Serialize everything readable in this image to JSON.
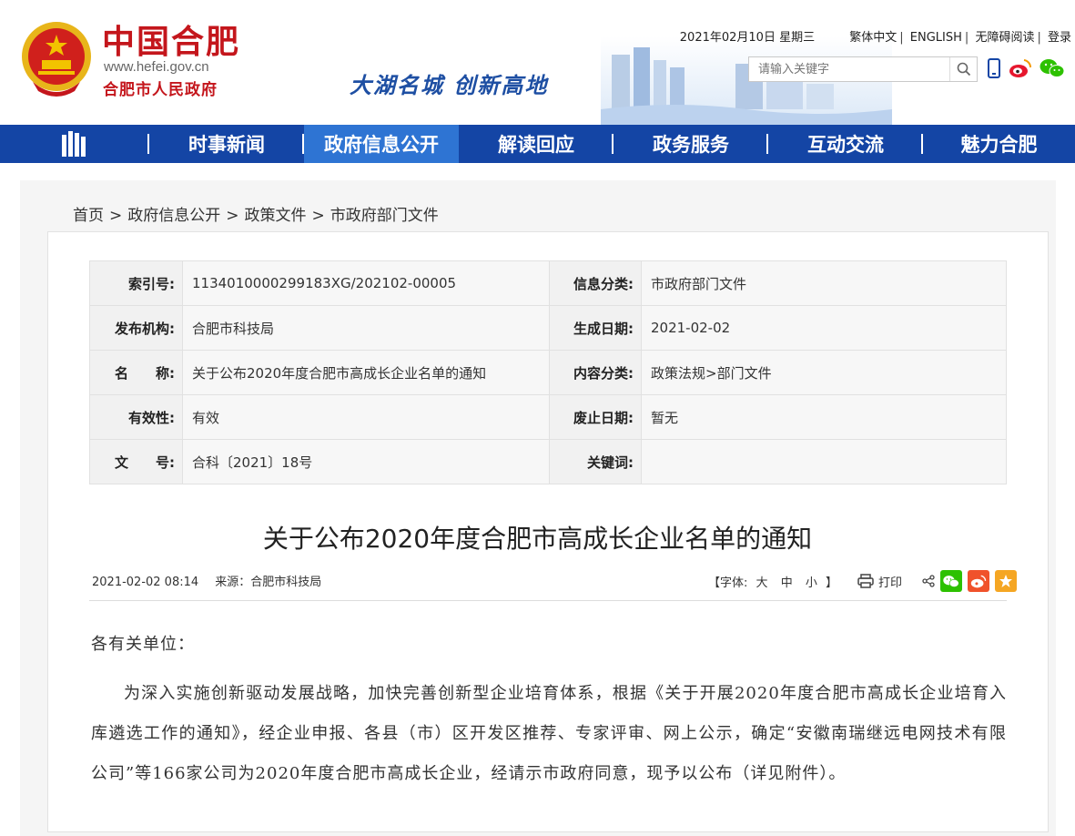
{
  "header": {
    "site_name": "中国合肥",
    "site_url": "www.hefei.gov.cn",
    "site_sub": "合肥市人民政府",
    "slogan": "大湖名城   创新高地",
    "date": "2021年02月10日 星期三",
    "links": [
      "繁体中文",
      "ENGLISH",
      "无障碍阅读",
      "登录"
    ],
    "search_placeholder": "请输入关键字",
    "icons": [
      "mobile-icon",
      "weibo-icon",
      "wechat-icon"
    ]
  },
  "nav": {
    "items": [
      "时事新闻",
      "政府信息公开",
      "解读回应",
      "政务服务",
      "互动交流",
      "魅力合肥"
    ],
    "active": "政府信息公开"
  },
  "breadcrumb": [
    "首页",
    "政府信息公开",
    "政策文件",
    "市政府部门文件"
  ],
  "meta": {
    "rows": [
      {
        "k1": "索引号:",
        "v1": "1134010000299183XG/202102-00005",
        "k2": "信息分类:",
        "v2": "市政府部门文件"
      },
      {
        "k1": "发布机构:",
        "v1": "合肥市科技局",
        "k2": "生成日期:",
        "v2": "2021-02-02"
      },
      {
        "k1": "名　　称:",
        "v1": "关于公布2020年度合肥市高成长企业名单的通知",
        "k2": "内容分类:",
        "v2": "政策法规>部门文件"
      },
      {
        "k1": "有效性:",
        "v1": "有效",
        "k2": "废止日期:",
        "v2": "暂无"
      },
      {
        "k1": "文　　号:",
        "v1": "合科〔2021〕18号",
        "k2": "关键词:",
        "v2": ""
      }
    ]
  },
  "article": {
    "title": "关于公布2020年度合肥市高成长企业名单的通知",
    "datetime": "2021-02-02 08:14",
    "source": "来源：合肥市科技局",
    "font_label": "【字体:",
    "font_sizes": [
      "大",
      "中",
      "小"
    ],
    "font_end": "】",
    "print_label": "打印",
    "salutation": "各有关单位：",
    "paragraph": "为深入实施创新驱动发展战略，加快完善创新型企业培育体系，根据《关于开展2020年度合肥市高成长企业培育入库遴选工作的通知》，经企业申报、各县（市）区开发区推荐、专家评审、网上公示，确定“安徽南瑞继远电网技术有限公司”等166家公司为2020年度合肥市高成长企业，经请示市政府同意，现予以公布（详见附件）。"
  },
  "colors": {
    "brand_red": "#c4161c",
    "nav_blue": "#1445a5",
    "nav_active": "#2e74d3",
    "wechat_green": "#2dc100",
    "weibo_orange": "#f0522b",
    "fav_orange": "#f5a623"
  }
}
